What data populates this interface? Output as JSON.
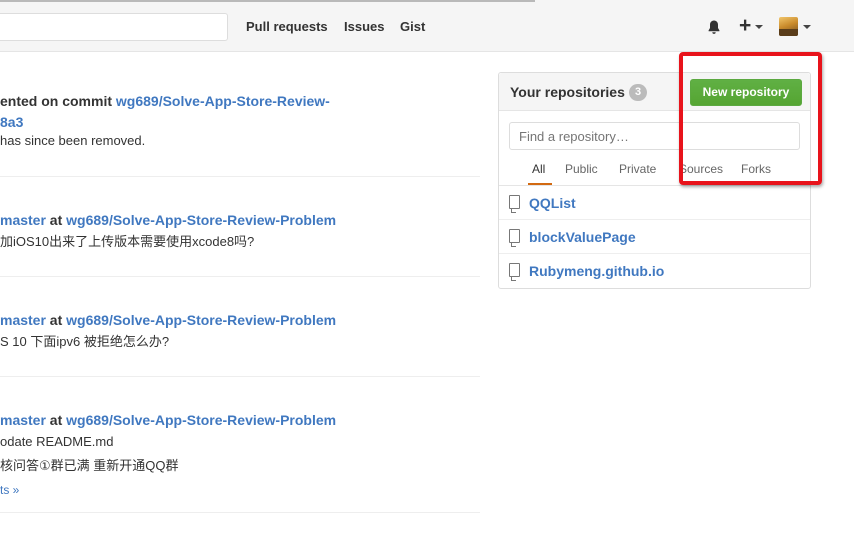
{
  "header": {
    "nav": [
      "Pull requests",
      "Issues",
      "Gist"
    ],
    "icons": [
      "bell-icon",
      "plus-icon",
      "chevron-down-icon",
      "avatar"
    ]
  },
  "feed": [
    {
      "title_prefix": "ented on commit ",
      "title_link": "wg689/Solve-App-Store-Review-",
      "line2_link": "8a3",
      "subtitle": " has since been removed."
    },
    {
      "title_prefix": "master",
      "title_at": " at ",
      "title_link": "wg689/Solve-App-Store-Review-Problem",
      "subtitle": "加iOS10出来了上传版本需要使用xcode8吗?"
    },
    {
      "title_prefix": "master",
      "title_at": " at ",
      "title_link": "wg689/Solve-App-Store-Review-Problem",
      "subtitle": "S 10 下面ipv6 被拒绝怎么办?"
    },
    {
      "title_prefix": "master",
      "title_at": " at ",
      "title_link": "wg689/Solve-App-Store-Review-Problem",
      "subtitle": "odate README.md",
      "subtitle2": "核问答①群已满 重新开通QQ群",
      "more": "ts »"
    }
  ],
  "repos_panel": {
    "title": "Your repositories",
    "count": "3",
    "new_button": "New repository",
    "search_placeholder": "Find a repository…",
    "tabs": [
      "All",
      "Public",
      "Private",
      "Sources",
      "Forks"
    ],
    "active_tab": "All",
    "repos": [
      "QQList",
      "blockValuePage",
      "Rubymeng.github.io"
    ]
  },
  "colors": {
    "link": "#4078c0",
    "primary_button": "#55a532",
    "active_tab_underline": "#d26911",
    "highlight_box": "#e8131b"
  }
}
